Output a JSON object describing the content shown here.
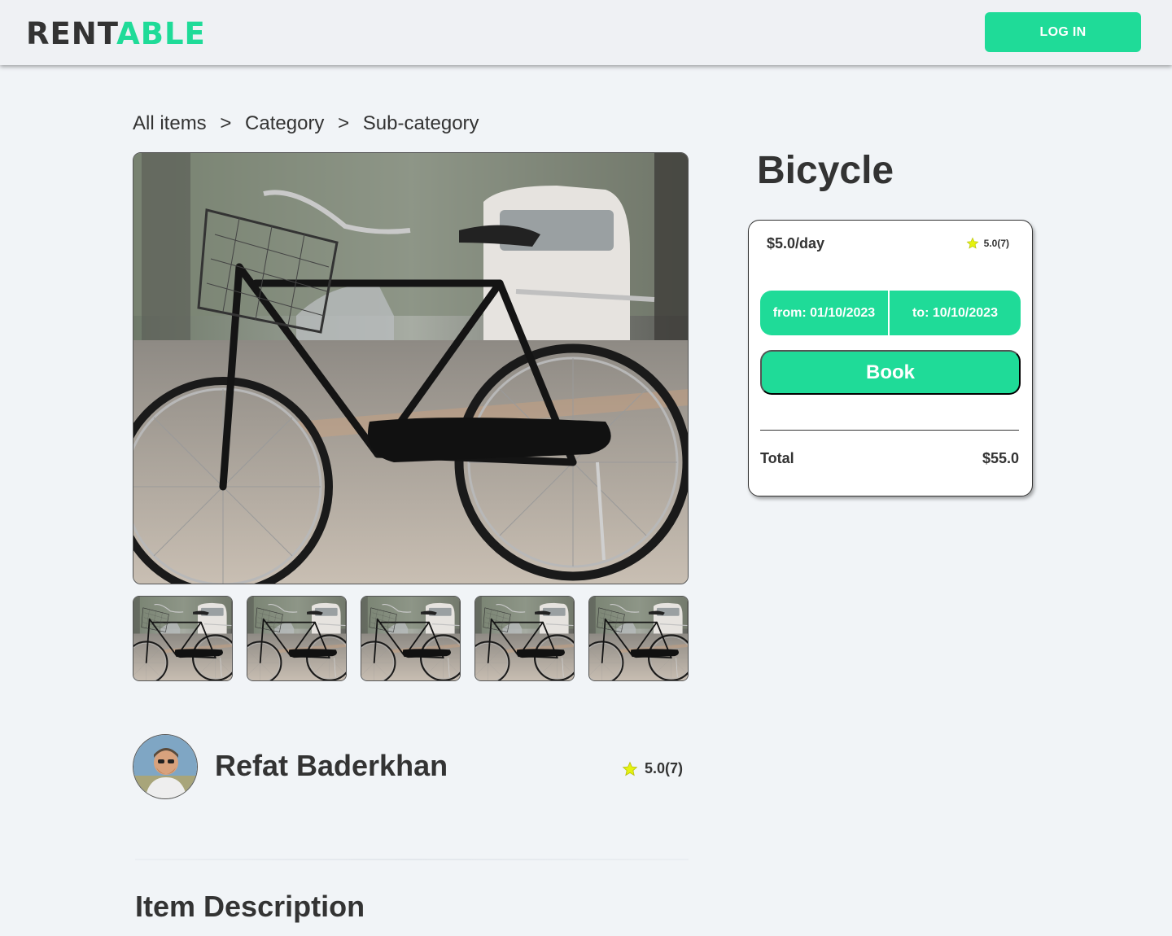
{
  "header": {
    "logo_part1": "RENT",
    "logo_part2": "ABLE",
    "login_label": "LOG IN",
    "accent_color": "#1fdb98"
  },
  "breadcrumb": {
    "items": [
      "All items",
      "Category",
      "Sub-category"
    ],
    "separator": ">"
  },
  "item": {
    "title": "Bicycle",
    "image_alt": "black vintage bicycle photo",
    "thumbnail_count": 5
  },
  "booking": {
    "price": "$5.0/day",
    "rating": "5.0(7)",
    "from": "from: 01/10/2023",
    "to": "to: 10/10/2023",
    "book_label": "Book",
    "total_label": "Total",
    "total_value": "$55.0"
  },
  "owner": {
    "name": "Refat Baderkhan",
    "rating": "5.0(7)"
  },
  "description": {
    "heading": "Item Description"
  },
  "icons": {
    "star": "star-icon"
  }
}
